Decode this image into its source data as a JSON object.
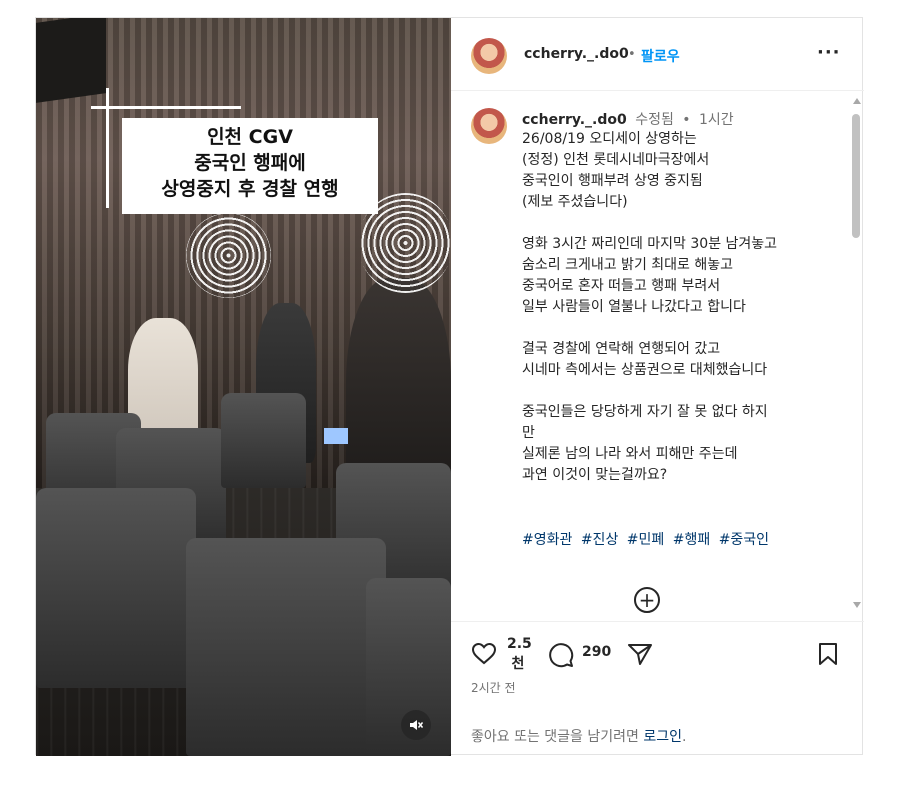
{
  "media": {
    "overlay_caption": [
      "인천 CGV",
      "중국인 행패에",
      "상영중지 후 경찰 연행"
    ],
    "mute_icon": "speaker-muted-icon"
  },
  "header": {
    "username": "ccherry._.do0",
    "separator": "•",
    "follow_label": "팔로우",
    "more_label": "···"
  },
  "post": {
    "username": "ccherry._.do0",
    "edited_label": "수정됨",
    "separator": "•",
    "time": "1시간",
    "caption": "26/08/19 오디세이 상영하는\n(정정) 인천 롯데시네마극장에서\n중국인이 행패부려 상영 중지됨\n(제보 주셨습니다)\n\n영화 3시간 짜리인데 마지막 30분 남겨놓고\n숨소리 크게내고 밝기 최대로 해놓고\n중국어로 혼자 떠들고 행패 부려서\n일부 사람들이 열불나 나갔다고 합니다\n\n결국 경찰에 연락해 연행되어 갔고\n시네마 측에서는 상품권으로 대체했습니다\n\n중국인들은 당당하게 자기 잘 못 없다 하지\n만\n실제론 남의 나라 와서 피해만 주는데\n과연 이것이 맞는걸까요?",
    "hashtags": [
      "#영화관",
      "#진상",
      "#민폐",
      "#행패",
      "#중국인"
    ]
  },
  "actions": {
    "likes": "2.5천",
    "likes_line1": "2.5",
    "likes_line2": "천",
    "comments": "290",
    "time_ago": "2시간 전",
    "login_prompt": "좋아요 또는 댓글을 남기려면 ",
    "login_link": "로그인",
    "login_suffix": "."
  },
  "colors": {
    "link_blue": "#0095f6",
    "hashtag_navy": "#00376b",
    "muted_text": "#737373"
  }
}
